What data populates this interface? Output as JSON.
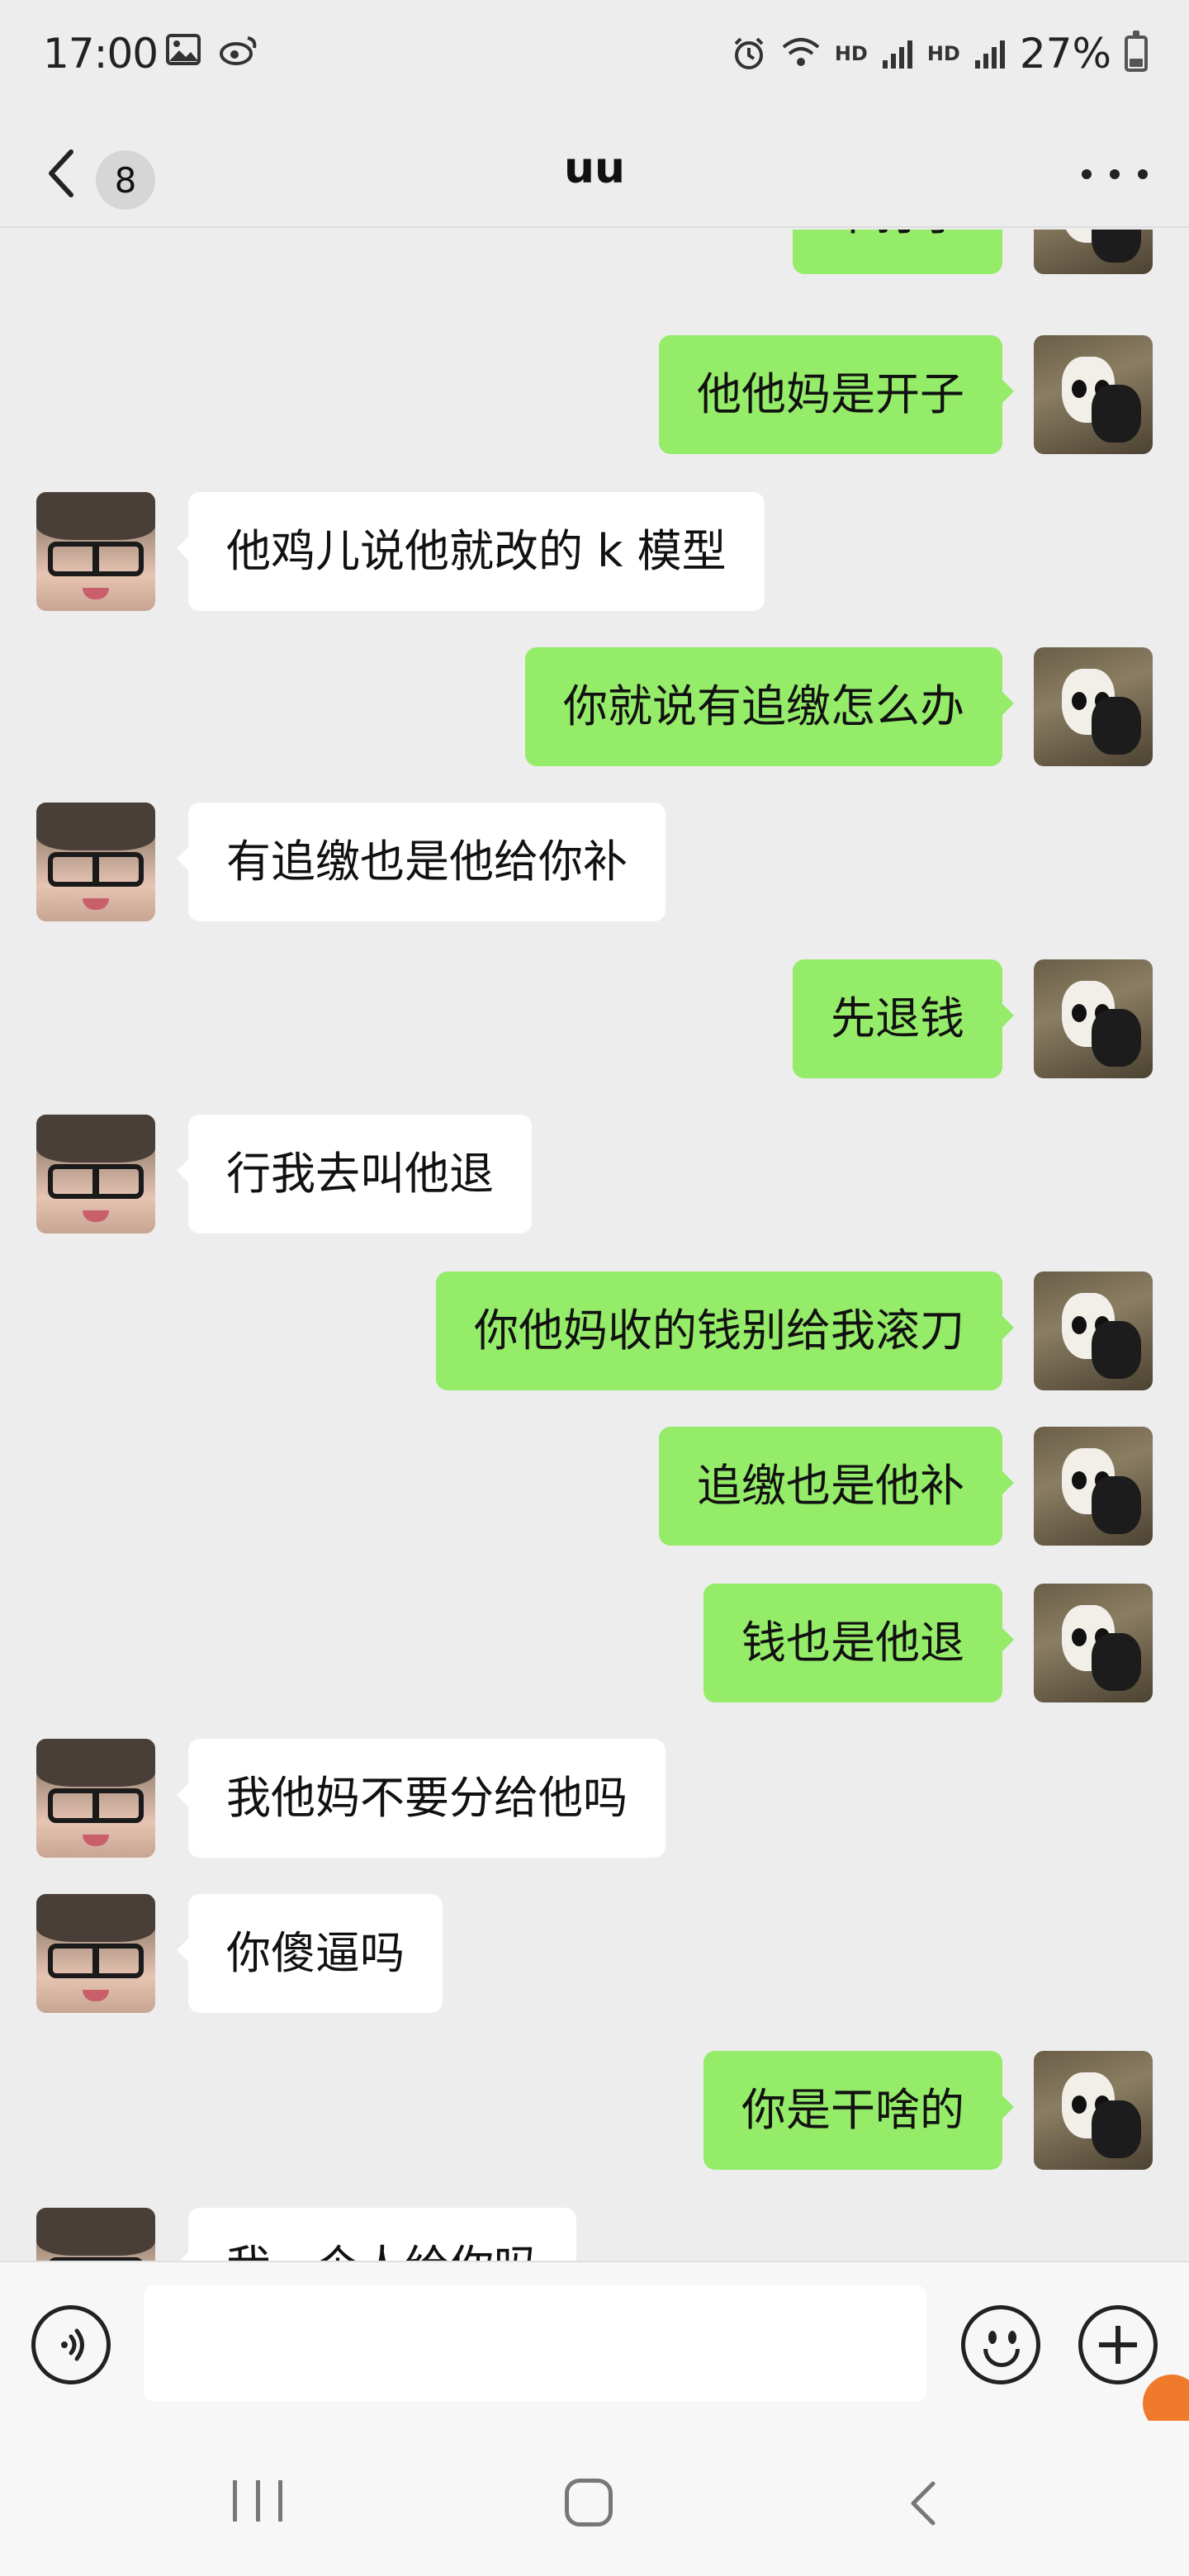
{
  "status_bar": {
    "time": "17:00",
    "network_1": "HD",
    "network_2": "HD",
    "battery_percent": "27%",
    "battery_level": 0.27
  },
  "header": {
    "back_badge_count": "8",
    "title": "uu"
  },
  "messages": [
    {
      "sender": "me",
      "text": "不打了"
    },
    {
      "sender": "me",
      "text": "他他妈是开子"
    },
    {
      "sender": "them",
      "text": "他鸡儿说他就改的 k 模型"
    },
    {
      "sender": "me",
      "text": "你就说有追缴怎么办"
    },
    {
      "sender": "them",
      "text": "有追缴也是他给你补"
    },
    {
      "sender": "me",
      "text": "先退钱"
    },
    {
      "sender": "them",
      "text": "行我去叫他退"
    },
    {
      "sender": "me",
      "text": "你他妈收的钱别给我滚刀"
    },
    {
      "sender": "me",
      "text": "追缴也是他补"
    },
    {
      "sender": "me",
      "text": "钱也是他退"
    },
    {
      "sender": "them",
      "text": "我他妈不要分给他吗"
    },
    {
      "sender": "them",
      "text": "你傻逼吗"
    },
    {
      "sender": "me",
      "text": "你是干啥的"
    },
    {
      "sender": "them",
      "text": "我一个人给你吗"
    }
  ],
  "input_bar": {
    "text_value": "",
    "placeholder": ""
  },
  "colors": {
    "my_bubble": "#95ec69",
    "their_bubble": "#ffffff",
    "background": "#ededed",
    "floating_badge": "#f07a2c"
  },
  "icons": {
    "status_left": [
      "gallery-icon",
      "weibo-icon"
    ],
    "status_right": [
      "alarm-icon",
      "wifi-icon",
      "signal-icon",
      "signal-icon",
      "battery-icon"
    ],
    "input": [
      "voice-icon",
      "emoji-icon",
      "plus-icon"
    ],
    "nav": [
      "recent-apps-icon",
      "home-icon",
      "back-icon"
    ]
  }
}
